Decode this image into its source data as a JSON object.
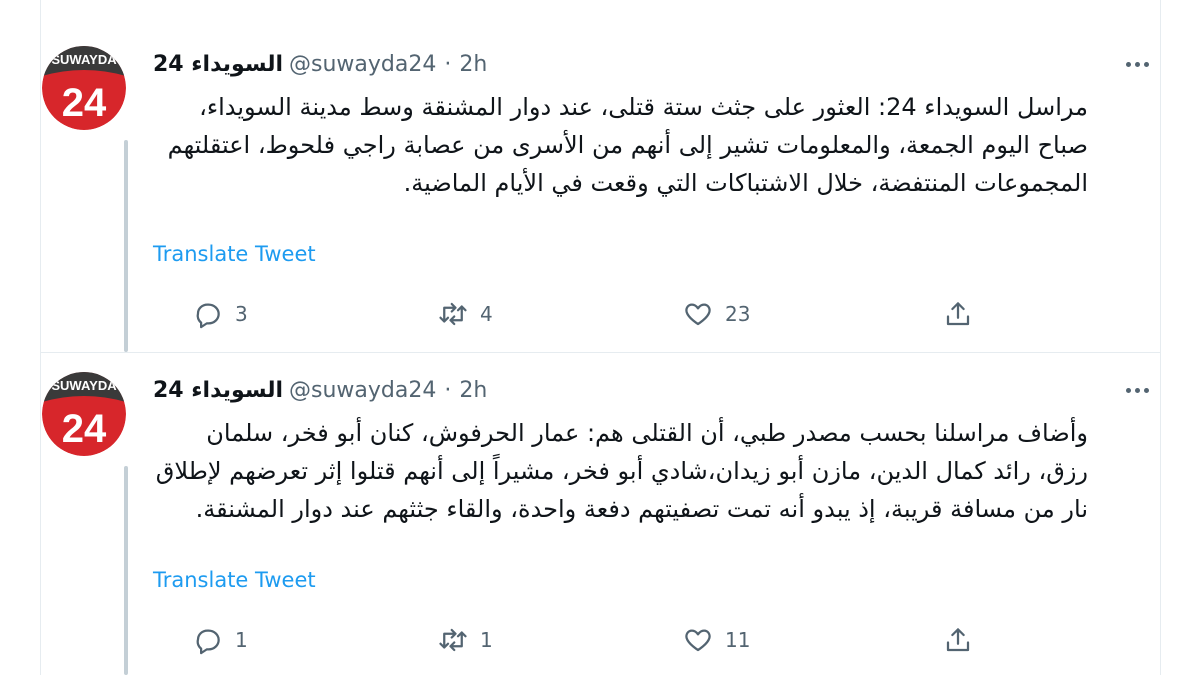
{
  "tweets": [
    {
      "name": "السويداء 24",
      "handle": "@suwayda24",
      "time": "2h",
      "avatar_text": "24",
      "avatar_banner": "SUWAYDA",
      "text": "مراسل السويداء 24: العثور على جثث ستة قتلى، عند دوار المشنقة وسط مدينة السويداء، صباح اليوم الجمعة، والمعلومات تشير إلى أنهم من الأسرى من عصابة راجي فلحوط، اعتقلتهم المجموعات المنتفضة، خلال الاشتباكات التي وقعت في الأيام الماضية.",
      "translate": "Translate Tweet",
      "replies": "3",
      "retweets": "4",
      "likes": "23"
    },
    {
      "name": "السويداء 24",
      "handle": "@suwayda24",
      "time": "2h",
      "avatar_text": "24",
      "avatar_banner": "SUWAYDA",
      "text": "وأضاف مراسلنا بحسب مصدر طبي، أن القتلى هم: عمار الحرفوش، كنان أبو فخر، سلمان رزق، رائد كمال الدين، مازن أبو زيدان،شادي أبو فخر، مشيراً إلى أنهم قتلوا إثر تعرضهم لإطلاق نار من مسافة قريبة، إذ يبدو أنه تمت تصفيتهم دفعة واحدة، والقاء جثثهم عند دوار المشنقة.",
      "translate": "Translate Tweet",
      "replies": "1",
      "retweets": "1",
      "likes": "11"
    }
  ],
  "colors": {
    "accent": "#1d9bf0",
    "muted": "#536471",
    "avatar_red": "#d7262b",
    "thread_line": "#c4cfd6"
  },
  "icons": [
    "reply-icon",
    "retweet-icon",
    "like-icon",
    "share-icon",
    "more-icon"
  ]
}
